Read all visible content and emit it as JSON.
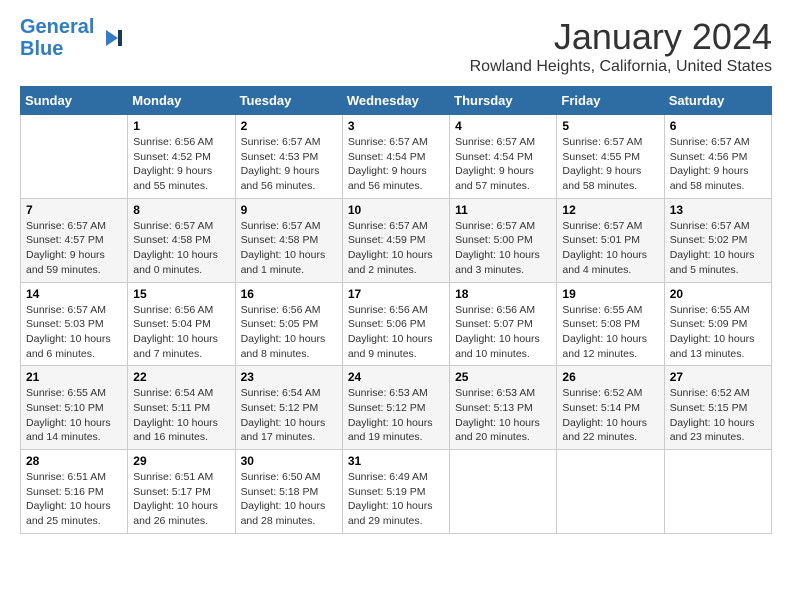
{
  "logo": {
    "line1": "General",
    "line2": "Blue"
  },
  "title": "January 2024",
  "location": "Rowland Heights, California, United States",
  "days_header": [
    "Sunday",
    "Monday",
    "Tuesday",
    "Wednesday",
    "Thursday",
    "Friday",
    "Saturday"
  ],
  "weeks": [
    [
      {
        "day": "",
        "info": ""
      },
      {
        "day": "1",
        "info": "Sunrise: 6:56 AM\nSunset: 4:52 PM\nDaylight: 9 hours\nand 55 minutes."
      },
      {
        "day": "2",
        "info": "Sunrise: 6:57 AM\nSunset: 4:53 PM\nDaylight: 9 hours\nand 56 minutes."
      },
      {
        "day": "3",
        "info": "Sunrise: 6:57 AM\nSunset: 4:54 PM\nDaylight: 9 hours\nand 56 minutes."
      },
      {
        "day": "4",
        "info": "Sunrise: 6:57 AM\nSunset: 4:54 PM\nDaylight: 9 hours\nand 57 minutes."
      },
      {
        "day": "5",
        "info": "Sunrise: 6:57 AM\nSunset: 4:55 PM\nDaylight: 9 hours\nand 58 minutes."
      },
      {
        "day": "6",
        "info": "Sunrise: 6:57 AM\nSunset: 4:56 PM\nDaylight: 9 hours\nand 58 minutes."
      }
    ],
    [
      {
        "day": "7",
        "info": "Sunrise: 6:57 AM\nSunset: 4:57 PM\nDaylight: 9 hours\nand 59 minutes."
      },
      {
        "day": "8",
        "info": "Sunrise: 6:57 AM\nSunset: 4:58 PM\nDaylight: 10 hours\nand 0 minutes."
      },
      {
        "day": "9",
        "info": "Sunrise: 6:57 AM\nSunset: 4:58 PM\nDaylight: 10 hours\nand 1 minute."
      },
      {
        "day": "10",
        "info": "Sunrise: 6:57 AM\nSunset: 4:59 PM\nDaylight: 10 hours\nand 2 minutes."
      },
      {
        "day": "11",
        "info": "Sunrise: 6:57 AM\nSunset: 5:00 PM\nDaylight: 10 hours\nand 3 minutes."
      },
      {
        "day": "12",
        "info": "Sunrise: 6:57 AM\nSunset: 5:01 PM\nDaylight: 10 hours\nand 4 minutes."
      },
      {
        "day": "13",
        "info": "Sunrise: 6:57 AM\nSunset: 5:02 PM\nDaylight: 10 hours\nand 5 minutes."
      }
    ],
    [
      {
        "day": "14",
        "info": "Sunrise: 6:57 AM\nSunset: 5:03 PM\nDaylight: 10 hours\nand 6 minutes."
      },
      {
        "day": "15",
        "info": "Sunrise: 6:56 AM\nSunset: 5:04 PM\nDaylight: 10 hours\nand 7 minutes."
      },
      {
        "day": "16",
        "info": "Sunrise: 6:56 AM\nSunset: 5:05 PM\nDaylight: 10 hours\nand 8 minutes."
      },
      {
        "day": "17",
        "info": "Sunrise: 6:56 AM\nSunset: 5:06 PM\nDaylight: 10 hours\nand 9 minutes."
      },
      {
        "day": "18",
        "info": "Sunrise: 6:56 AM\nSunset: 5:07 PM\nDaylight: 10 hours\nand 10 minutes."
      },
      {
        "day": "19",
        "info": "Sunrise: 6:55 AM\nSunset: 5:08 PM\nDaylight: 10 hours\nand 12 minutes."
      },
      {
        "day": "20",
        "info": "Sunrise: 6:55 AM\nSunset: 5:09 PM\nDaylight: 10 hours\nand 13 minutes."
      }
    ],
    [
      {
        "day": "21",
        "info": "Sunrise: 6:55 AM\nSunset: 5:10 PM\nDaylight: 10 hours\nand 14 minutes."
      },
      {
        "day": "22",
        "info": "Sunrise: 6:54 AM\nSunset: 5:11 PM\nDaylight: 10 hours\nand 16 minutes."
      },
      {
        "day": "23",
        "info": "Sunrise: 6:54 AM\nSunset: 5:12 PM\nDaylight: 10 hours\nand 17 minutes."
      },
      {
        "day": "24",
        "info": "Sunrise: 6:53 AM\nSunset: 5:12 PM\nDaylight: 10 hours\nand 19 minutes."
      },
      {
        "day": "25",
        "info": "Sunrise: 6:53 AM\nSunset: 5:13 PM\nDaylight: 10 hours\nand 20 minutes."
      },
      {
        "day": "26",
        "info": "Sunrise: 6:52 AM\nSunset: 5:14 PM\nDaylight: 10 hours\nand 22 minutes."
      },
      {
        "day": "27",
        "info": "Sunrise: 6:52 AM\nSunset: 5:15 PM\nDaylight: 10 hours\nand 23 minutes."
      }
    ],
    [
      {
        "day": "28",
        "info": "Sunrise: 6:51 AM\nSunset: 5:16 PM\nDaylight: 10 hours\nand 25 minutes."
      },
      {
        "day": "29",
        "info": "Sunrise: 6:51 AM\nSunset: 5:17 PM\nDaylight: 10 hours\nand 26 minutes."
      },
      {
        "day": "30",
        "info": "Sunrise: 6:50 AM\nSunset: 5:18 PM\nDaylight: 10 hours\nand 28 minutes."
      },
      {
        "day": "31",
        "info": "Sunrise: 6:49 AM\nSunset: 5:19 PM\nDaylight: 10 hours\nand 29 minutes."
      },
      {
        "day": "",
        "info": ""
      },
      {
        "day": "",
        "info": ""
      },
      {
        "day": "",
        "info": ""
      }
    ]
  ]
}
